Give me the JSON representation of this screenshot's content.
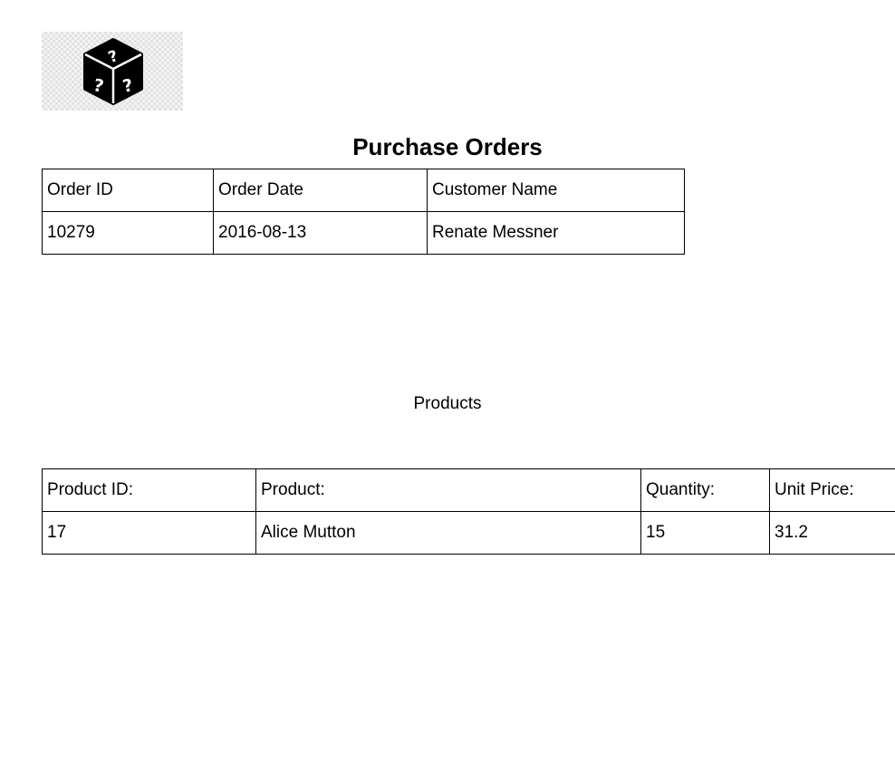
{
  "logo": {
    "icon": "mystery-dice-icon"
  },
  "title": "Purchase Orders",
  "orders": {
    "headers": [
      "Order ID",
      "Order Date",
      "Customer Name"
    ],
    "rows": [
      [
        "10279",
        "2016-08-13",
        "Renate Messner"
      ]
    ]
  },
  "products": {
    "caption": "Products",
    "headers": [
      "Product ID:",
      "Product:",
      "Quantity:",
      "Unit Price:"
    ],
    "rows": [
      [
        "17",
        "Alice Mutton",
        "15",
        "31.2"
      ]
    ]
  }
}
